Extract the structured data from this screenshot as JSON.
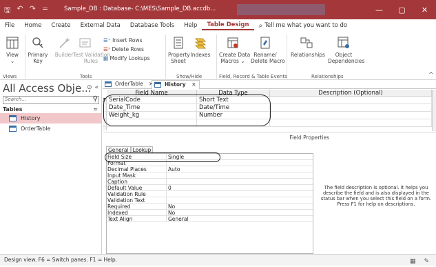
{
  "titlebar": {
    "title": "Sample_DB : Database- C:\\MES\\Sample_DB.accdb...",
    "save_glyph": "🖫",
    "undo_glyph": "↶",
    "redo_glyph": "↷",
    "customize_glyph": "=",
    "minimize_glyph": "—",
    "restore_glyph": "▢",
    "close_glyph": "✕",
    "colors": {
      "accent": "#a4373a"
    }
  },
  "menu": {
    "items": [
      "File",
      "Home",
      "Create",
      "External Data",
      "Database Tools",
      "Help",
      "Table Design"
    ],
    "active": "Table Design",
    "tell_me_glyph": "⌕",
    "tell_me": "Tell me what you want to do"
  },
  "ribbon": {
    "view": {
      "label": "View",
      "sub": "⌄"
    },
    "primary_key": {
      "line1": "Primary",
      "line2": "Key"
    },
    "builder": "Builder",
    "test_validation": {
      "line1": "Test Validation",
      "line2": "Rules"
    },
    "insert_rows": "Insert Rows",
    "delete_rows": "Delete Rows",
    "modify_lookups": "Modify Lookups",
    "property_sheet": {
      "line1": "Property",
      "line2": "Sheet"
    },
    "indexes": "Indexes",
    "create_data_macros": {
      "line1": "Create Data",
      "line2": "Macros ⌄"
    },
    "rename_delete_macro": {
      "line1": "Rename/",
      "line2": "Delete Macro"
    },
    "relationships": "Relationships",
    "object_dependencies": {
      "line1": "Object",
      "line2": "Dependencies"
    },
    "groups": {
      "views": "Views",
      "tools": "Tools",
      "show_hide": "Show/Hide",
      "field_record_table_events": "Field, Record & Table Events",
      "relationships": "Relationships"
    },
    "collapse_glyph": "^"
  },
  "nav": {
    "header": "All Access Obje...",
    "header_menu_glyph": "⊙",
    "collapse_glyph": "«",
    "search_placeholder": "Search...",
    "search_glyph": "⚲",
    "category": "Tables",
    "category_glyph": "≈",
    "items": [
      {
        "label": "History",
        "selected": true
      },
      {
        "label": "OrderTable",
        "selected": false
      }
    ]
  },
  "tabs": [
    {
      "label": "OrderTable",
      "close": "✕",
      "active": false
    },
    {
      "label": "History",
      "close": "✕",
      "active": true
    }
  ],
  "design_grid": {
    "headers": [
      "Field Name",
      "Data Type",
      "Description (Optional)"
    ],
    "row_marker": "⁋",
    "rows": [
      {
        "field": "SerialCode",
        "type": "Short Text",
        "description": ""
      },
      {
        "field": "Date_Time",
        "type": "Date/Time",
        "description": ""
      },
      {
        "field": "Weight_kg",
        "type": "Number",
        "description": ""
      }
    ]
  },
  "field_properties": {
    "title": "Field Properties",
    "tabs": [
      "General",
      "Lookup"
    ],
    "active_tab": "General",
    "rows": [
      {
        "label": "Field Size",
        "value": "Single"
      },
      {
        "label": "Format",
        "value": ""
      },
      {
        "label": "Decimal Places",
        "value": "Auto"
      },
      {
        "label": "Input Mask",
        "value": ""
      },
      {
        "label": "Caption",
        "value": ""
      },
      {
        "label": "Default Value",
        "value": "0"
      },
      {
        "label": "Validation Rule",
        "value": ""
      },
      {
        "label": "Validation Text",
        "value": ""
      },
      {
        "label": "Required",
        "value": "No"
      },
      {
        "label": "Indexed",
        "value": "No"
      },
      {
        "label": "Text Align",
        "value": "General"
      }
    ],
    "help_text": "The field description is optional. It helps you describe the field and is also displayed in the status bar when you select this field on a form. Press F1 for help on descriptions."
  },
  "status": {
    "text": "Design view.  F6 = Switch panes.  F1 = Help.",
    "datasheet_glyph": "▦",
    "design_glyph": "✎"
  }
}
